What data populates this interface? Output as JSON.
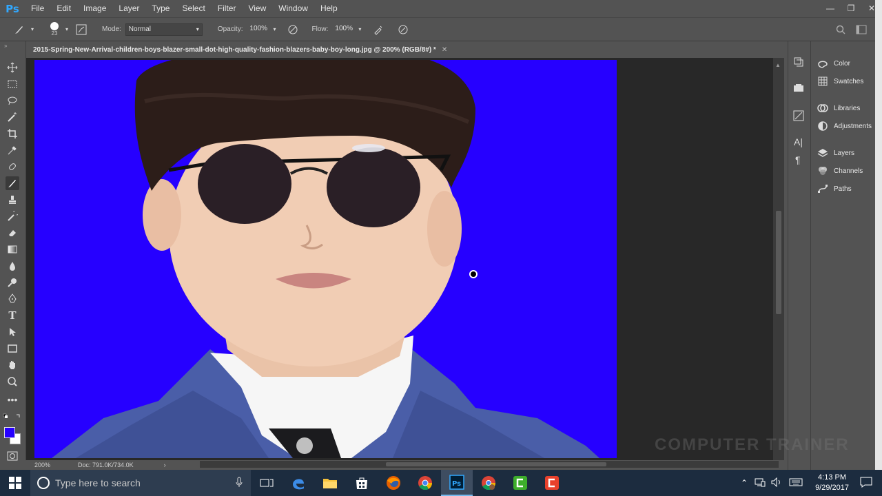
{
  "app": {
    "logo": "Ps",
    "menu": [
      "File",
      "Edit",
      "Image",
      "Layer",
      "Type",
      "Select",
      "Filter",
      "View",
      "Window",
      "Help"
    ],
    "window_controls": [
      "minimize-icon",
      "restore-icon",
      "close-icon"
    ]
  },
  "options": {
    "brush_size": "23",
    "mode_label": "Mode:",
    "mode_value": "Normal",
    "opacity_label": "Opacity:",
    "opacity_value": "100%",
    "flow_label": "Flow:",
    "flow_value": "100%"
  },
  "document": {
    "tab_title": "2015-Spring-New-Arrival-children-boys-blazer-small-dot-high-quality-fashion-blazers-baby-boy-long.jpg @ 200% (RGB/8#) *",
    "zoom": "200%",
    "doc_info": "Doc: 791.0K/734.0K",
    "canvas_color": "#2600ff"
  },
  "tools": [
    "move-tool-icon",
    "marquee-tool-icon",
    "lasso-tool-icon",
    "magic-wand-icon",
    "crop-tool-icon",
    "eyedropper-icon",
    "healing-brush-icon",
    "brush-tool-icon",
    "clone-stamp-icon",
    "history-brush-icon",
    "eraser-icon",
    "gradient-icon",
    "blur-icon",
    "dodge-icon",
    "pen-tool-icon",
    "type-tool-icon",
    "path-selection-icon",
    "rectangle-tool-icon",
    "hand-tool-icon",
    "zoom-tool-icon",
    "more-tools-icon"
  ],
  "colors": {
    "foreground": "#2600ff",
    "background": "#ffffff"
  },
  "panels": [
    {
      "label": "Color",
      "icon": "color-icon"
    },
    {
      "label": "Swatches",
      "icon": "swatches-icon"
    },
    {
      "label": "Libraries",
      "icon": "libraries-icon"
    },
    {
      "label": "Adjustments",
      "icon": "adjustments-icon"
    },
    {
      "label": "Layers",
      "icon": "layers-icon"
    },
    {
      "label": "Channels",
      "icon": "channels-icon"
    },
    {
      "label": "Paths",
      "icon": "paths-icon"
    }
  ],
  "watermark": "COMPUTER TRAINER",
  "taskbar": {
    "search_placeholder": "Type here to search",
    "time": "4:13 PM",
    "date": "9/29/2017",
    "apps": [
      "task-view-icon",
      "edge-icon",
      "file-explorer-icon",
      "store-icon",
      "firefox-icon",
      "chrome-icon",
      "photoshop-icon",
      "chrome-alt-icon",
      "camtasia-green-icon",
      "camtasia-red-icon"
    ]
  }
}
